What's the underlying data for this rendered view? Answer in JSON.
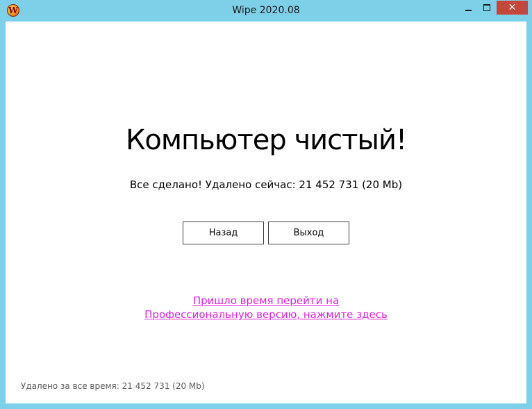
{
  "window": {
    "title": "Wipe 2020.08",
    "icon": "wipe-app-icon",
    "icon_letter": "W",
    "controls": {
      "minimize": "minimize",
      "maximize": "maximize",
      "close": "✕"
    }
  },
  "main": {
    "headline": "Компьютер чистый!",
    "status_text": "Все сделано! Удалено сейчас: 21 452 731 (20 Mb)",
    "buttons": {
      "back": "Назад",
      "exit": "Выход"
    },
    "promo_line1": "Пришло время перейти на",
    "promo_line2": "Профессиональную версию, нажмите здесь"
  },
  "footer": {
    "total_deleted": "Удалено за все время: 21 452 731 (20 Mb)"
  },
  "colors": {
    "frame": "#7ecfe8",
    "close_button": "#c7463c",
    "link": "#e020e0"
  }
}
